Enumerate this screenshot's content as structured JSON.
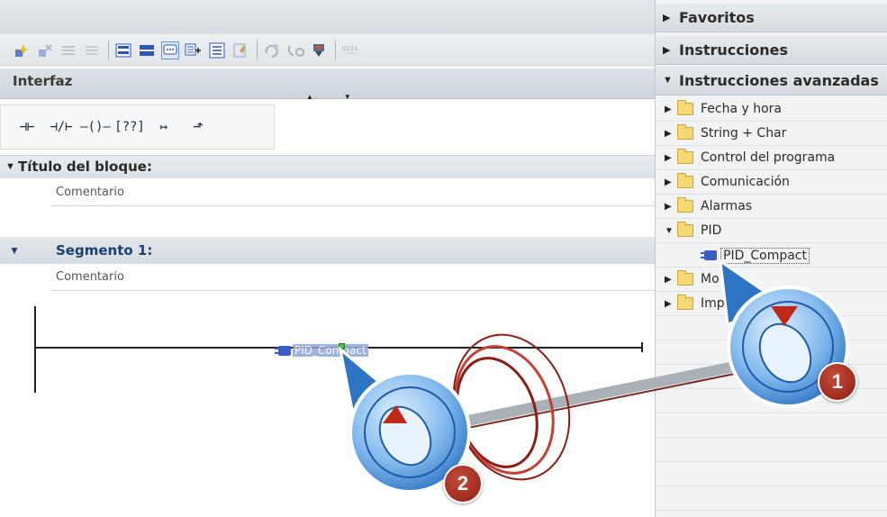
{
  "editor": {
    "interfaz_label": "Interfaz",
    "block_title": "Título del bloque:",
    "block_comment": "Comentario",
    "segment_title": "Segmento 1:",
    "segment_comment": "Comentario",
    "dropped_block_label": "PID_Compact"
  },
  "toolbar": {
    "icons": [
      "insert-block-icon",
      "remove-block-icon",
      "insert-network-icon",
      "delete-network-icon",
      "expand-all-icon",
      "collapse-all-icon",
      "comment-icon",
      "insert-comment-icon",
      "absolute-operand-icon",
      "symbol-list-icon",
      "monitor-icon",
      "previous-error-icon",
      "next-error-icon",
      "download-icon",
      "display-format-icon"
    ]
  },
  "ladder_toolbar": {
    "items": [
      {
        "name": "no-contact-icon",
        "glyph": "⊣⊢"
      },
      {
        "name": "nc-contact-icon",
        "glyph": "⊣/⊢"
      },
      {
        "name": "coil-icon",
        "glyph": "–()–"
      },
      {
        "name": "empty-box-icon",
        "glyph": "[??]"
      },
      {
        "name": "open-branch-icon",
        "glyph": "↦"
      },
      {
        "name": "close-branch-icon",
        "glyph": "⬏"
      }
    ]
  },
  "panel": {
    "favorites": "Favoritos",
    "instructions": "Instrucciones",
    "advanced": "Instrucciones avanzadas",
    "tree": [
      {
        "label": "Fecha y hora",
        "expanded": false
      },
      {
        "label": "String + Char",
        "expanded": false
      },
      {
        "label": "Control del programa",
        "expanded": false
      },
      {
        "label": "Comunicación",
        "expanded": false
      },
      {
        "label": "Alarmas",
        "expanded": false
      },
      {
        "label": "PID",
        "expanded": true
      },
      {
        "label": "PID_Compact",
        "child": true
      },
      {
        "label": "Mo",
        "expanded": false
      },
      {
        "label": "Imp",
        "expanded": false
      }
    ]
  },
  "badges": {
    "step1": "1",
    "step2": "2"
  },
  "colors": {
    "accent": "#1d3f72",
    "drop_marker": "#48c238",
    "badge": "#a0281c",
    "folder": "#f6d874"
  }
}
